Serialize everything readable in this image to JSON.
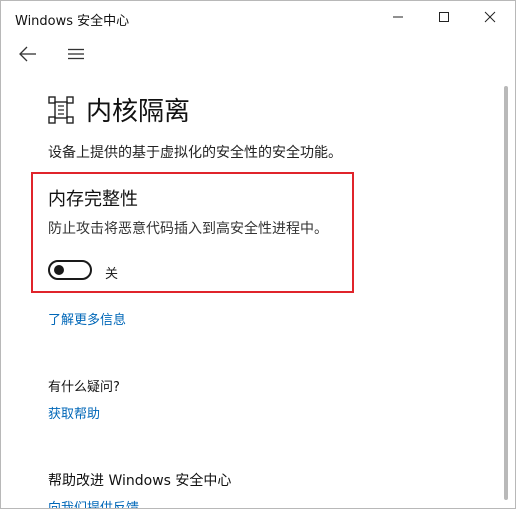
{
  "window": {
    "title": "Windows 安全中心"
  },
  "page": {
    "title": "内核隔离",
    "description": "设备上提供的基于虚拟化的安全性的安全功能。"
  },
  "memory_integrity": {
    "title": "内存完整性",
    "description": "防止攻击将恶意代码插入到高安全性进程中。",
    "toggle_state_label": "关",
    "toggle_on": false
  },
  "links": {
    "learn_more": "了解更多信息"
  },
  "questions": {
    "title": "有什么疑问?",
    "get_help": "获取帮助"
  },
  "improve": {
    "title": "帮助改进 Windows 安全中心",
    "feedback": "向我们提供反馈"
  },
  "colors": {
    "accent_link": "#0067b8",
    "highlight_border": "#e0242b"
  },
  "icons": {
    "back": "arrow-left-icon",
    "menu": "hamburger-menu-icon",
    "page": "core-isolation-chip-icon",
    "minimize": "minimize-icon",
    "maximize": "maximize-icon",
    "close": "close-icon"
  }
}
